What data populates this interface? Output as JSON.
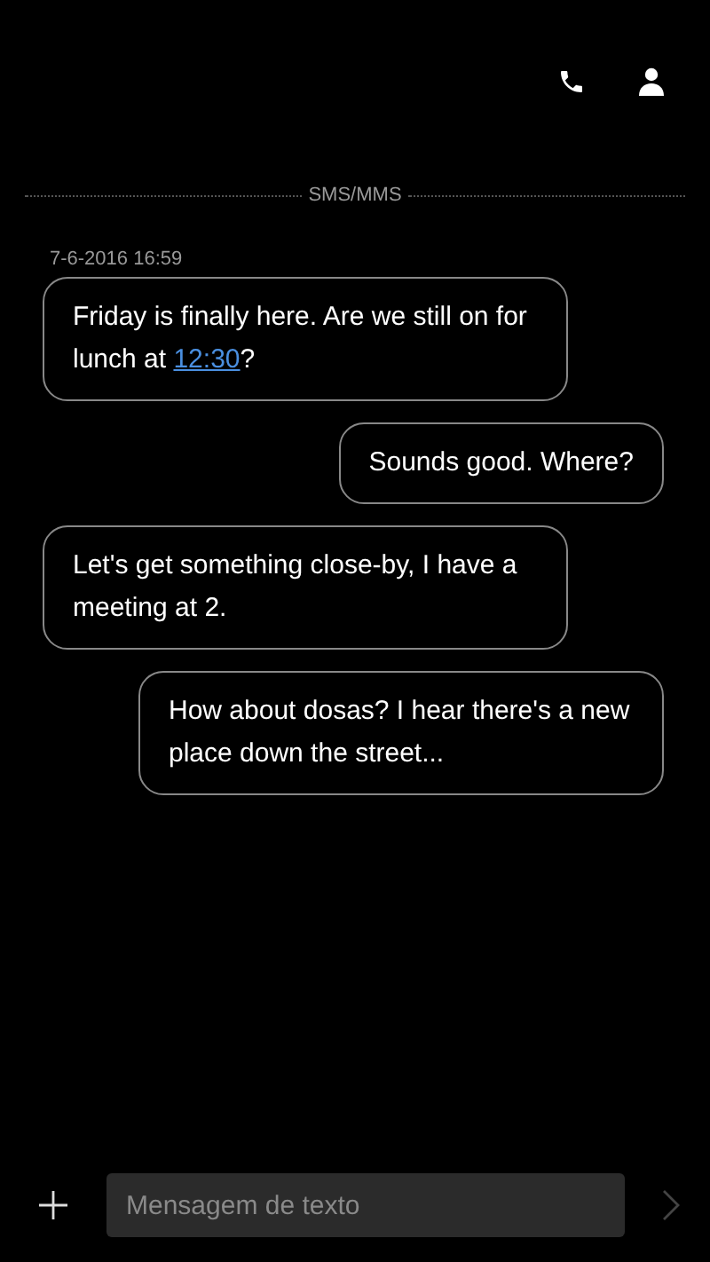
{
  "channel_label": "SMS/MMS",
  "timestamp": "7-6-2016 16:59",
  "messages": [
    {
      "kind": "incoming",
      "parts": [
        {
          "kind": "plain",
          "text": "Friday is finally here. Are we still on for lunch at "
        },
        {
          "kind": "link",
          "text": "12:30"
        },
        {
          "kind": "plain",
          "text": "?"
        }
      ]
    },
    {
      "kind": "outgoing",
      "parts": [
        {
          "kind": "plain",
          "text": "Sounds good. Where?"
        }
      ]
    },
    {
      "kind": "incoming",
      "parts": [
        {
          "kind": "plain",
          "text": "Let's get something close-by, I have a meeting at 2."
        }
      ]
    },
    {
      "kind": "outgoing",
      "parts": [
        {
          "kind": "plain",
          "text": "How about dosas? I hear there's a new place down the street..."
        }
      ]
    }
  ],
  "composer": {
    "placeholder": "Mensagem de texto"
  }
}
